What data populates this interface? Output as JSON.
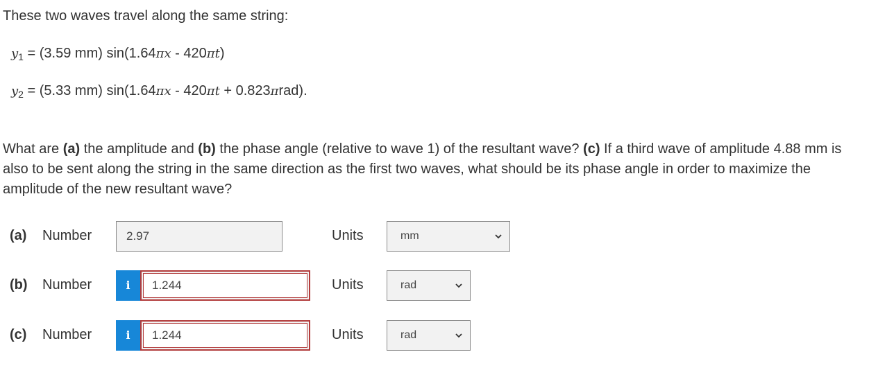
{
  "intro": "These two waves travel along the same string:",
  "wave1": {
    "label_var": "y",
    "label_sub": "1",
    "pre": " = (3.59 mm) sin(1.64",
    "pi1": "π",
    "x": "x",
    "mid": " - 420",
    "pi2": "π",
    "t": "t",
    "post": ")"
  },
  "wave2": {
    "label_var": "y",
    "label_sub": "2",
    "pre": " = (5.33 mm) sin(1.64",
    "pi1": "π",
    "x": "x",
    "mid": " - 420",
    "pi2": "π",
    "t": "t",
    "mid2": " + 0.823",
    "pi3": "π",
    "post": "rad)."
  },
  "question": {
    "p1": "What are ",
    "a": "(a)",
    "p2": " the amplitude and ",
    "b": "(b)",
    "p3": " the phase angle (relative to wave 1) of the resultant wave? ",
    "c": "(c)",
    "p4": " If a third wave of amplitude 4.88 mm is also to be sent along the string in the same direction as the first two waves, what should be its phase angle in order to maximize the amplitude of the new resultant wave?"
  },
  "parts": [
    {
      "part": "(a)",
      "number_label": "Number",
      "value": "2.97",
      "units_label": "Units",
      "unit": "mm",
      "info": ""
    },
    {
      "part": "(b)",
      "number_label": "Number",
      "value": "1.244",
      "units_label": "Units",
      "unit": "rad",
      "info": "i"
    },
    {
      "part": "(c)",
      "number_label": "Number",
      "value": "1.244",
      "units_label": "Units",
      "unit": "rad",
      "info": "i"
    }
  ]
}
